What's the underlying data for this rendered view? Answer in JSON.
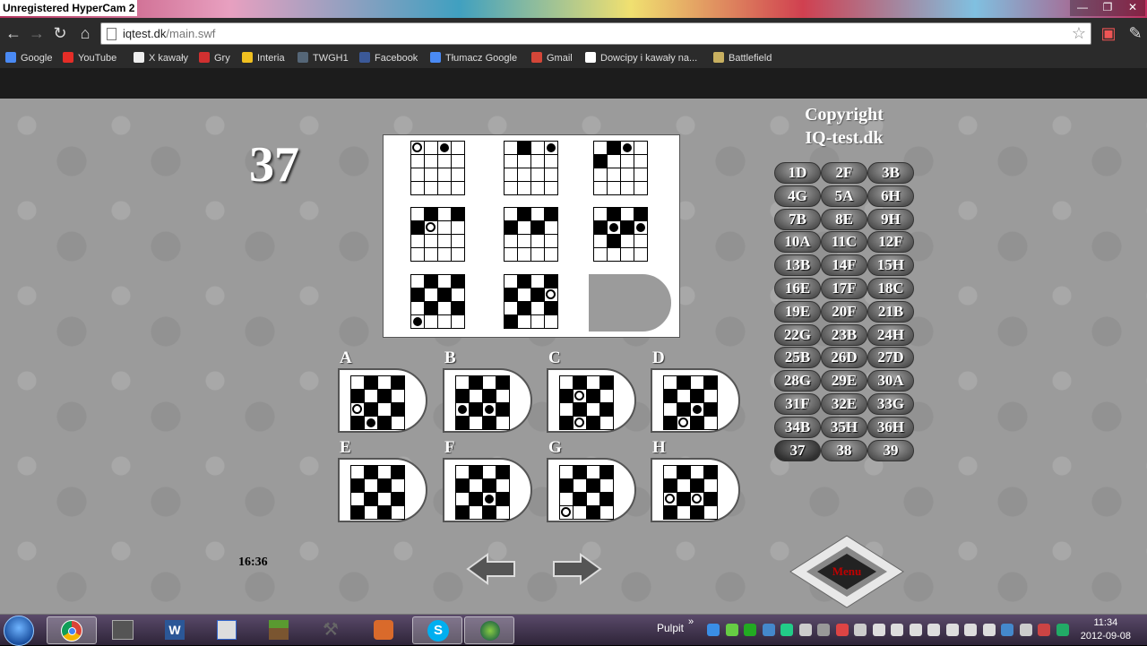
{
  "window": {
    "hypercam_label": "Unregistered HyperCam 2"
  },
  "browser": {
    "url_host": "iqtest.dk",
    "url_path": "/main.swf",
    "bookmarks": [
      {
        "label": "Google",
        "icon": "google-icon",
        "color": "#4a8af4"
      },
      {
        "label": "YouTube",
        "icon": "youtube-icon",
        "color": "#e52d27"
      },
      {
        "label": "X kawały",
        "icon": "page-icon",
        "color": "#eeeeee"
      },
      {
        "label": "Gry",
        "icon": "gry-icon",
        "color": "#d03030"
      },
      {
        "label": "Interia",
        "icon": "interia-icon",
        "color": "#f0c020"
      },
      {
        "label": "TWGH1",
        "icon": "twgh-icon",
        "color": "#556677"
      },
      {
        "label": "Facebook",
        "icon": "facebook-icon",
        "color": "#3b5998"
      },
      {
        "label": "Tłumacz Google",
        "icon": "translate-icon",
        "color": "#4a8af4"
      },
      {
        "label": "Gmail",
        "icon": "gmail-icon",
        "color": "#d44638"
      },
      {
        "label": "Dowcipy i kawały na...",
        "icon": "smiley-icon",
        "color": "#ffffff"
      },
      {
        "label": "Battlefield",
        "icon": "battlefield-icon",
        "color": "#c8b060"
      }
    ]
  },
  "test": {
    "question_number": "37",
    "copyright": [
      "Copyright",
      "IQ-test.dk"
    ],
    "timer": "16:36",
    "menu_label": "Menu",
    "option_letters": [
      "A",
      "B",
      "C",
      "D",
      "E",
      "F",
      "G",
      "H"
    ],
    "answers": [
      "1D",
      "2F",
      "3B",
      "4G",
      "5A",
      "6H",
      "7B",
      "8E",
      "9H",
      "10A",
      "11C",
      "12F",
      "13B",
      "14F",
      "15H",
      "16E",
      "17F",
      "18C",
      "19E",
      "20F",
      "21B",
      "22G",
      "23B",
      "24H",
      "25B",
      "26D",
      "27D",
      "28G",
      "29E",
      "30A",
      "31F",
      "32E",
      "33G",
      "34B",
      "35H",
      "36H",
      "37",
      "38",
      "39"
    ]
  },
  "taskbar": {
    "pulpit": "Pulpit",
    "time": "11:34",
    "date": "2012-09-08"
  }
}
